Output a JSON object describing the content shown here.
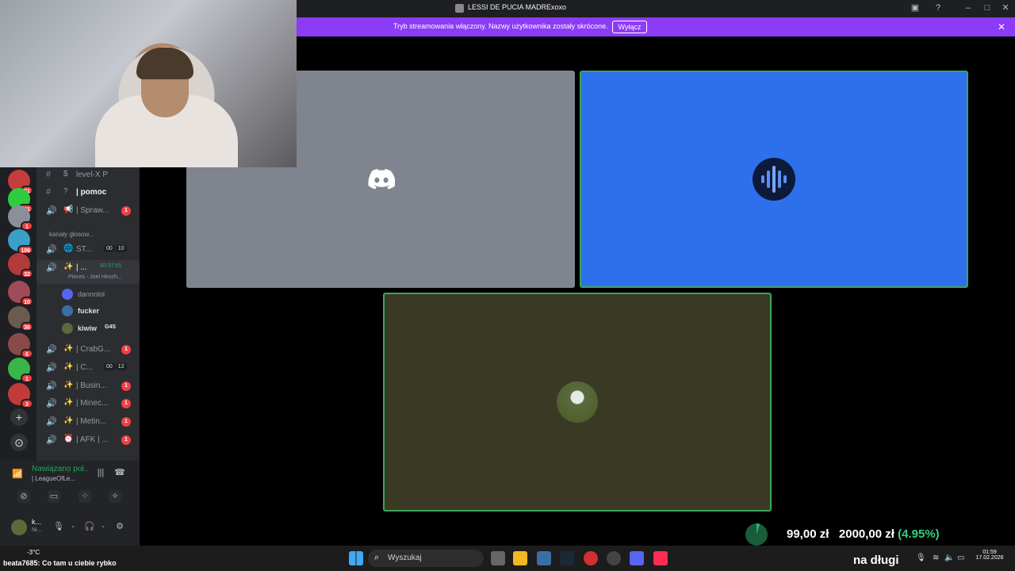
{
  "window": {
    "title": "LESSI DE PUCIA MADRExoxo"
  },
  "banner": {
    "text": "Tryb streamowania włączony. Nazwy użytkownika zostały skrócone.",
    "button_label": "Wyłącz",
    "color": "#8c3bf7"
  },
  "servers": [
    {
      "badge": "21",
      "color": "#c43c3c"
    },
    {
      "badge": "211",
      "color": "#2ecc40"
    },
    {
      "badge": "1",
      "color": "#8a8f98"
    },
    {
      "badge": "106",
      "color": "#3aa0c8"
    },
    {
      "badge": "32",
      "color": "#b33a3a"
    },
    {
      "badge": "10",
      "color": "#a04a5a"
    },
    {
      "badge": "36",
      "color": "#6a5a50"
    },
    {
      "badge": "6",
      "color": "#8a4a4a"
    },
    {
      "badge": "1",
      "color": "#3ab54a"
    },
    {
      "badge": "3",
      "color": "#c23a3a"
    }
  ],
  "channels": [
    {
      "icon": "#",
      "emoji": "$",
      "name": "level-X P",
      "type": "text"
    },
    {
      "icon": "#",
      "emoji": "?",
      "name": "| pomoc",
      "type": "text",
      "bold": true
    },
    {
      "icon": "🔊",
      "emoji": "📢",
      "name": "| Spraw...",
      "badge": "1"
    },
    {
      "category": "kanały głosow..."
    },
    {
      "icon": "🔊",
      "emoji": "🌐",
      "name": "ST...",
      "counts": [
        "00",
        "10"
      ]
    },
    {
      "icon": "🔊",
      "emoji": "✨",
      "name": "| ...",
      "timer": "60:37:05",
      "activity": "Pieces - Joel Hirsch...",
      "active": true
    },
    {
      "icon": "🔊",
      "emoji": "✨",
      "name": "| CrabG...",
      "badge": "1"
    },
    {
      "icon": "🔊",
      "emoji": "✨",
      "name": "| C...",
      "counts": [
        "00",
        "12"
      ]
    },
    {
      "icon": "🔊",
      "emoji": "✨",
      "name": "| Busin...",
      "badge": "1"
    },
    {
      "icon": "🔊",
      "emoji": "✨",
      "name": "| Minec...",
      "badge": "1"
    },
    {
      "icon": "🔊",
      "emoji": "✨",
      "name": "| Metin...",
      "badge": "1"
    },
    {
      "icon": "🔊",
      "emoji": "⏰",
      "name": "| AFK | ...",
      "badge": "1"
    }
  ],
  "voice_users": [
    {
      "name": "dannnlol"
    },
    {
      "name": "fucker"
    },
    {
      "name": "kiwiw",
      "tag": "G4S"
    }
  ],
  "voice_panel": {
    "status": "Nawiązano poł...",
    "channel": "| LeagueOfLe...",
    "user_short": "k...",
    "user_sub": "Ni..."
  },
  "overlay": {
    "current": "99,00 zł",
    "goal": "2000,00 zł",
    "percent": "(4.95%)",
    "progress_fraction": 0.0495,
    "tagline": "na długi",
    "chat_user": "beata7685",
    "chat_message": ": Co tam u ciebie rybko"
  },
  "taskbar": {
    "weather": "-3°C",
    "search_placeholder": "Wyszukaj",
    "time": "01:59",
    "date": "17.02.2026"
  }
}
